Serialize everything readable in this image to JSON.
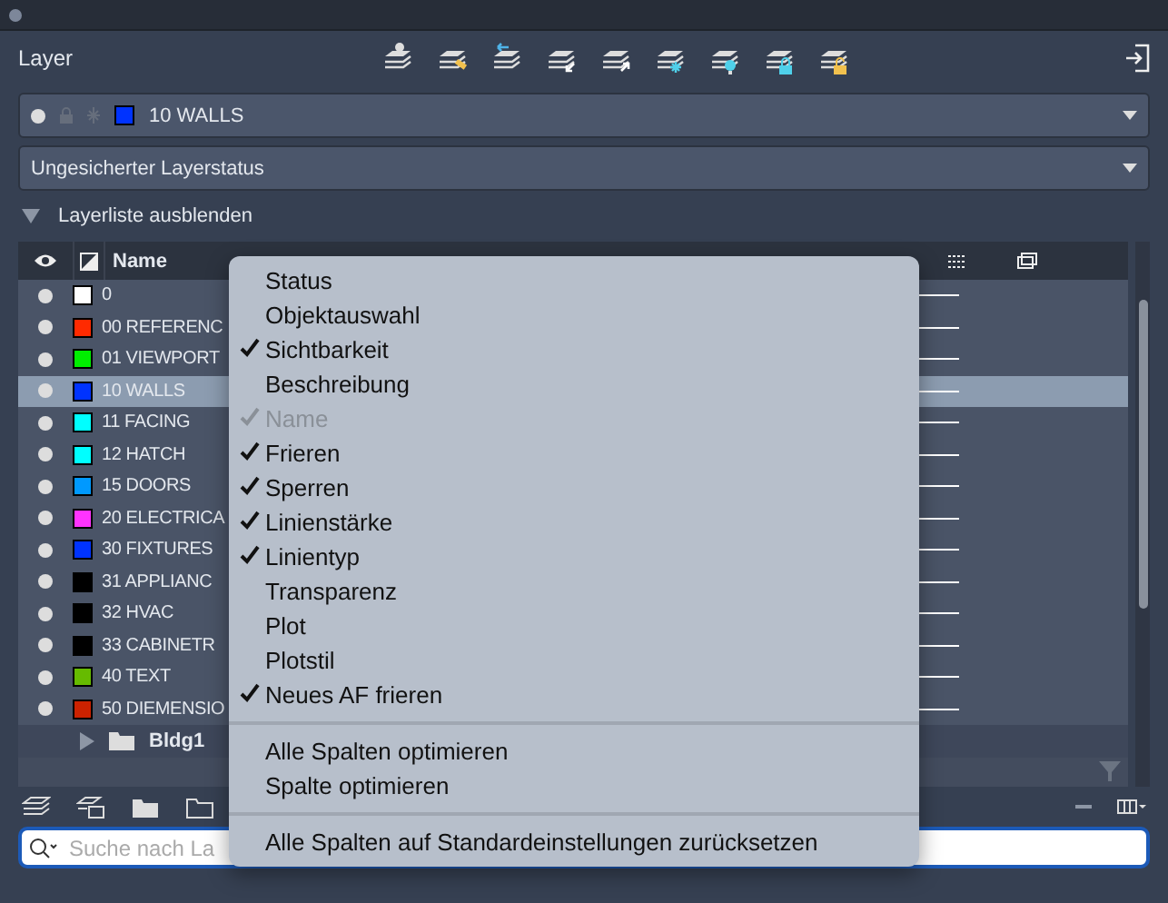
{
  "panel": {
    "title": "Layer"
  },
  "current_layer": {
    "name": "10 WALLS",
    "color": "#0033ff"
  },
  "layer_state": {
    "value": "Ungesicherter Layerstatus"
  },
  "toggle": {
    "label": "Layerliste ausblenden",
    "expanded": true
  },
  "table": {
    "columns": [
      {
        "label": "Name"
      }
    ],
    "rows": [
      {
        "name": "0",
        "color": "#ffffff",
        "selected": false
      },
      {
        "name": "00 REFERENC",
        "color": "#ff2a00",
        "selected": false
      },
      {
        "name": "01 VIEWPORT",
        "color": "#00ee00",
        "selected": false
      },
      {
        "name": "10 WALLS",
        "color": "#0033ff",
        "selected": true
      },
      {
        "name": "11 FACING",
        "color": "#00ffff",
        "selected": false
      },
      {
        "name": "12 HATCH",
        "color": "#00ffff",
        "selected": false
      },
      {
        "name": "15 DOORS",
        "color": "#0099ff",
        "selected": false
      },
      {
        "name": "20 ELECTRICA",
        "color": "#ff33ff",
        "selected": false
      },
      {
        "name": "30 FIXTURES",
        "color": "#0033ff",
        "selected": false
      },
      {
        "name": "31 APPLIANC",
        "color": "#000000",
        "selected": false
      },
      {
        "name": "32 HVAC",
        "color": "#000000",
        "selected": false
      },
      {
        "name": "33 CABINETR",
        "color": "#000000",
        "selected": false
      },
      {
        "name": "40 TEXT",
        "color": "#66bb00",
        "selected": false
      },
      {
        "name": "50 DIEMENSIO",
        "color": "#cc2200",
        "selected": false
      }
    ],
    "groups": [
      {
        "name": "Bldg1",
        "expanded": false
      }
    ]
  },
  "search": {
    "placeholder": "Suche nach La"
  },
  "context_menu": {
    "sections": [
      [
        {
          "label": "Status",
          "checked": false,
          "disabled": false
        },
        {
          "label": "Objektauswahl",
          "checked": false,
          "disabled": false
        },
        {
          "label": "Sichtbarkeit",
          "checked": true,
          "disabled": false
        },
        {
          "label": "Beschreibung",
          "checked": false,
          "disabled": false
        },
        {
          "label": "Name",
          "checked": true,
          "disabled": true
        },
        {
          "label": "Frieren",
          "checked": true,
          "disabled": false
        },
        {
          "label": "Sperren",
          "checked": true,
          "disabled": false
        },
        {
          "label": "Linienstärke",
          "checked": true,
          "disabled": false
        },
        {
          "label": "Linientyp",
          "checked": true,
          "disabled": false
        },
        {
          "label": "Transparenz",
          "checked": false,
          "disabled": false
        },
        {
          "label": "Plot",
          "checked": false,
          "disabled": false
        },
        {
          "label": "Plotstil",
          "checked": false,
          "disabled": false
        },
        {
          "label": "Neues AF frieren",
          "checked": true,
          "disabled": false
        }
      ],
      [
        {
          "label": "Alle Spalten optimieren",
          "checked": false,
          "disabled": false
        },
        {
          "label": "Spalte optimieren",
          "checked": false,
          "disabled": false
        }
      ],
      [
        {
          "label": "Alle Spalten auf Standardeinstellungen zurücksetzen",
          "checked": false,
          "disabled": false
        }
      ]
    ]
  }
}
